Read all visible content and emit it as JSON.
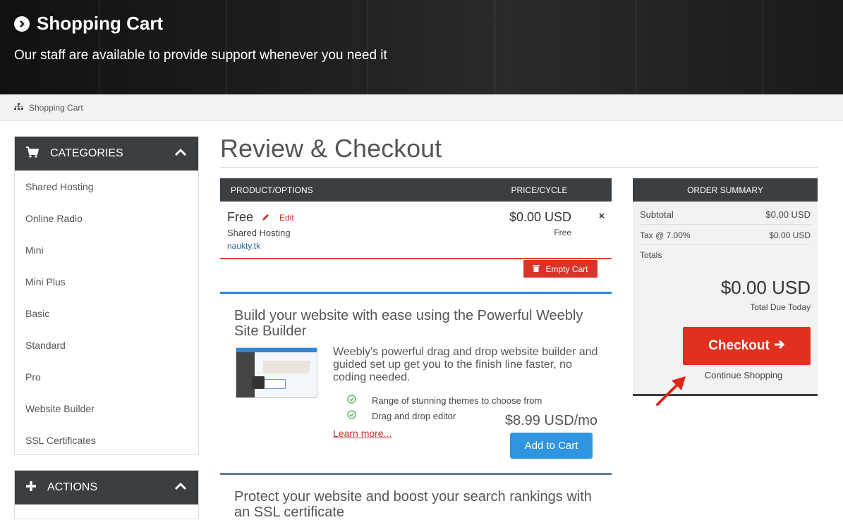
{
  "header": {
    "title": "Shopping Cart",
    "subtitle": "Our staff are available to provide support whenever you need it"
  },
  "breadcrumb": {
    "label": "Shopping Cart"
  },
  "sidebar": {
    "categories_title": "CATEGORIES",
    "categories": [
      "Shared Hosting",
      "Online Radio",
      "Mini",
      "Mini Plus",
      "Basic",
      "Standard",
      "Pro",
      "Website Builder",
      "SSL Certificates"
    ],
    "actions_title": "ACTIONS"
  },
  "main": {
    "title": "Review & Checkout",
    "cart_header": {
      "product": "PRODUCT/OPTIONS",
      "price": "PRICE/CYCLE"
    },
    "item": {
      "name": "Free",
      "edit": "Edit",
      "type": "Shared Hosting",
      "domain": "naukty.tk",
      "price": "$0.00 USD",
      "cycle": "Free",
      "remove": "×"
    },
    "empty_cart": "Empty Cart"
  },
  "promo1": {
    "title": "Build your website with ease using the Powerful Weebly Site Builder",
    "description": "Weebly's powerful drag and drop website builder and guided set up get you to the finish line faster, no coding needed.",
    "features": [
      "Range of stunning themes to choose from",
      "Drag and drop editor"
    ],
    "learn_more": "Learn more...",
    "price": "$8.99 USD/mo",
    "add_to_cart": "Add to Cart"
  },
  "promo2": {
    "title": "Protect your website and boost your search rankings with an SSL certificate"
  },
  "summary": {
    "title": "ORDER SUMMARY",
    "subtotal_label": "Subtotal",
    "subtotal_value": "$0.00 USD",
    "tax_label": "Tax @ 7.00%",
    "tax_value": "$0.00 USD",
    "totals_label": "Totals",
    "total": "$0.00 USD",
    "total_due_label": "Total Due Today",
    "checkout": "Checkout",
    "continue": "Continue Shopping"
  },
  "colors": {
    "dark_header": "#3a3f44",
    "checkout_red": "#e2301f",
    "add_cart_blue": "#2f95e0",
    "link_red": "#c9302c"
  }
}
